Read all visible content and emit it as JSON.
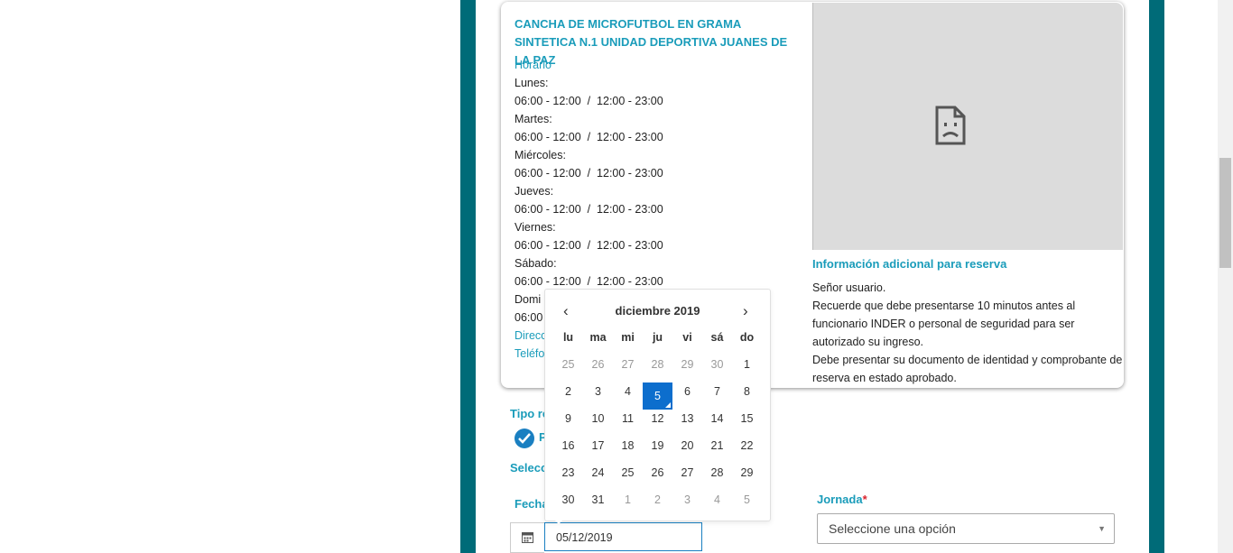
{
  "card": {
    "title": "CANCHA DE MICROFUTBOL EN GRAMA SINTETICA N.1 UNIDAD DEPORTIVA JUANES DE LA PAZ",
    "horario_label": "Horario",
    "days": [
      {
        "day": "Lunes:",
        "hours": "06:00 - 12:00  /  12:00 - 23:00"
      },
      {
        "day": "Martes:",
        "hours": "06:00 - 12:00  /  12:00 - 23:00"
      },
      {
        "day": "Miércoles:",
        "hours": "06:00 - 12:00  /  12:00 - 23:00"
      },
      {
        "day": "Jueves:",
        "hours": "06:00 - 12:00  /  12:00 - 23:00"
      },
      {
        "day": "Viernes:",
        "hours": "06:00 - 12:00  /  12:00 - 23:00"
      },
      {
        "day": "Sábado:",
        "hours": "06:00 - 12:00  /  12:00 - 23:00"
      },
      {
        "day": "Domi",
        "hours": "06:00"
      }
    ],
    "direccion_label": "Direcc",
    "telefono_label": "Teléfo",
    "image_icon": "broken-image-icon",
    "info_title": "Información adicional para reserva",
    "info_lines": [
      "Señor usuario.",
      "Recuerde que debe presentarse 10 minutos antes al funcionario INDER o personal de seguridad para ser autorizado su ingreso.",
      "Debe presentar su documento de identidad y comprobante de reserva en estado aprobado."
    ]
  },
  "form": {
    "tipo_label": "Tipo re",
    "tipo_option": "P",
    "seleccione_label": "Selecc",
    "fecha_label": "Fecha",
    "date_value": "05/12/2019",
    "jornada_label": "Jornada",
    "required_mark": "*",
    "jornada_placeholder": "Seleccione una opción"
  },
  "calendar": {
    "month_title": "diciembre 2019",
    "prev": "‹",
    "next": "›",
    "weekdays": [
      "lu",
      "ma",
      "mi",
      "ju",
      "vi",
      "sá",
      "do"
    ],
    "days": [
      [
        "25",
        "26",
        "27",
        "28",
        "29",
        "30",
        "1"
      ],
      [
        "2",
        "3",
        "4",
        "5",
        "6",
        "7",
        "8"
      ],
      [
        "9",
        "10",
        "11",
        "12",
        "13",
        "14",
        "15"
      ],
      [
        "16",
        "17",
        "18",
        "19",
        "20",
        "21",
        "22"
      ],
      [
        "23",
        "24",
        "25",
        "26",
        "27",
        "28",
        "29"
      ],
      [
        "30",
        "31",
        "1",
        "2",
        "3",
        "4",
        "5"
      ]
    ],
    "selected_day": "5"
  },
  "colors": {
    "accent": "#1a9cba",
    "frame": "#006b78",
    "selected": "#0d6ecd"
  }
}
